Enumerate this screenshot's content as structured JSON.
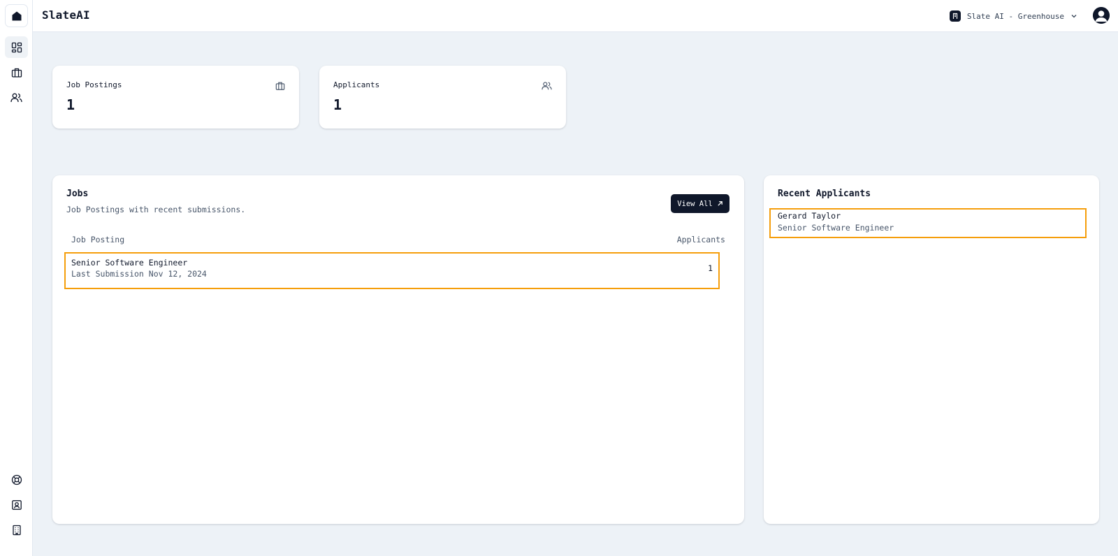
{
  "app": {
    "brand": "SlateAI"
  },
  "header": {
    "org_name": "Slate AI - Greenhouse",
    "org_icon": "org-badge-icon",
    "avatar_icon": "user-avatar-icon"
  },
  "sidebar": {
    "items": [
      {
        "name": "dashboard",
        "icon": "dashboard-icon",
        "active": true
      },
      {
        "name": "jobs",
        "icon": "briefcase-icon",
        "active": false
      },
      {
        "name": "applicants",
        "icon": "users-icon",
        "active": false
      }
    ],
    "bottom_items": [
      {
        "name": "help",
        "icon": "lifebuoy-icon"
      },
      {
        "name": "contacts",
        "icon": "contact-card-icon"
      },
      {
        "name": "company",
        "icon": "building-icon"
      }
    ]
  },
  "stats": [
    {
      "title": "Job Postings",
      "value": "1",
      "icon": "briefcase-icon"
    },
    {
      "title": "Applicants",
      "value": "1",
      "icon": "users-icon"
    }
  ],
  "jobs": {
    "title": "Jobs",
    "subtitle": "Job Postings with recent submissions.",
    "view_all_label": "View All",
    "columns": [
      "Job Posting",
      "Applicants"
    ],
    "rows": [
      {
        "title": "Senior Software Engineer",
        "subtitle": "Last Submission Nov 12, 2024",
        "applicants": "1"
      }
    ]
  },
  "recent_applicants": {
    "title": "Recent Applicants",
    "items": [
      {
        "name": "Gerard Taylor",
        "role": "Senior Software Engineer"
      }
    ]
  },
  "colors": {
    "background": "#edf2f7",
    "primary": "#0f172a",
    "muted_text": "#475569",
    "highlight": "#f59e0b"
  }
}
